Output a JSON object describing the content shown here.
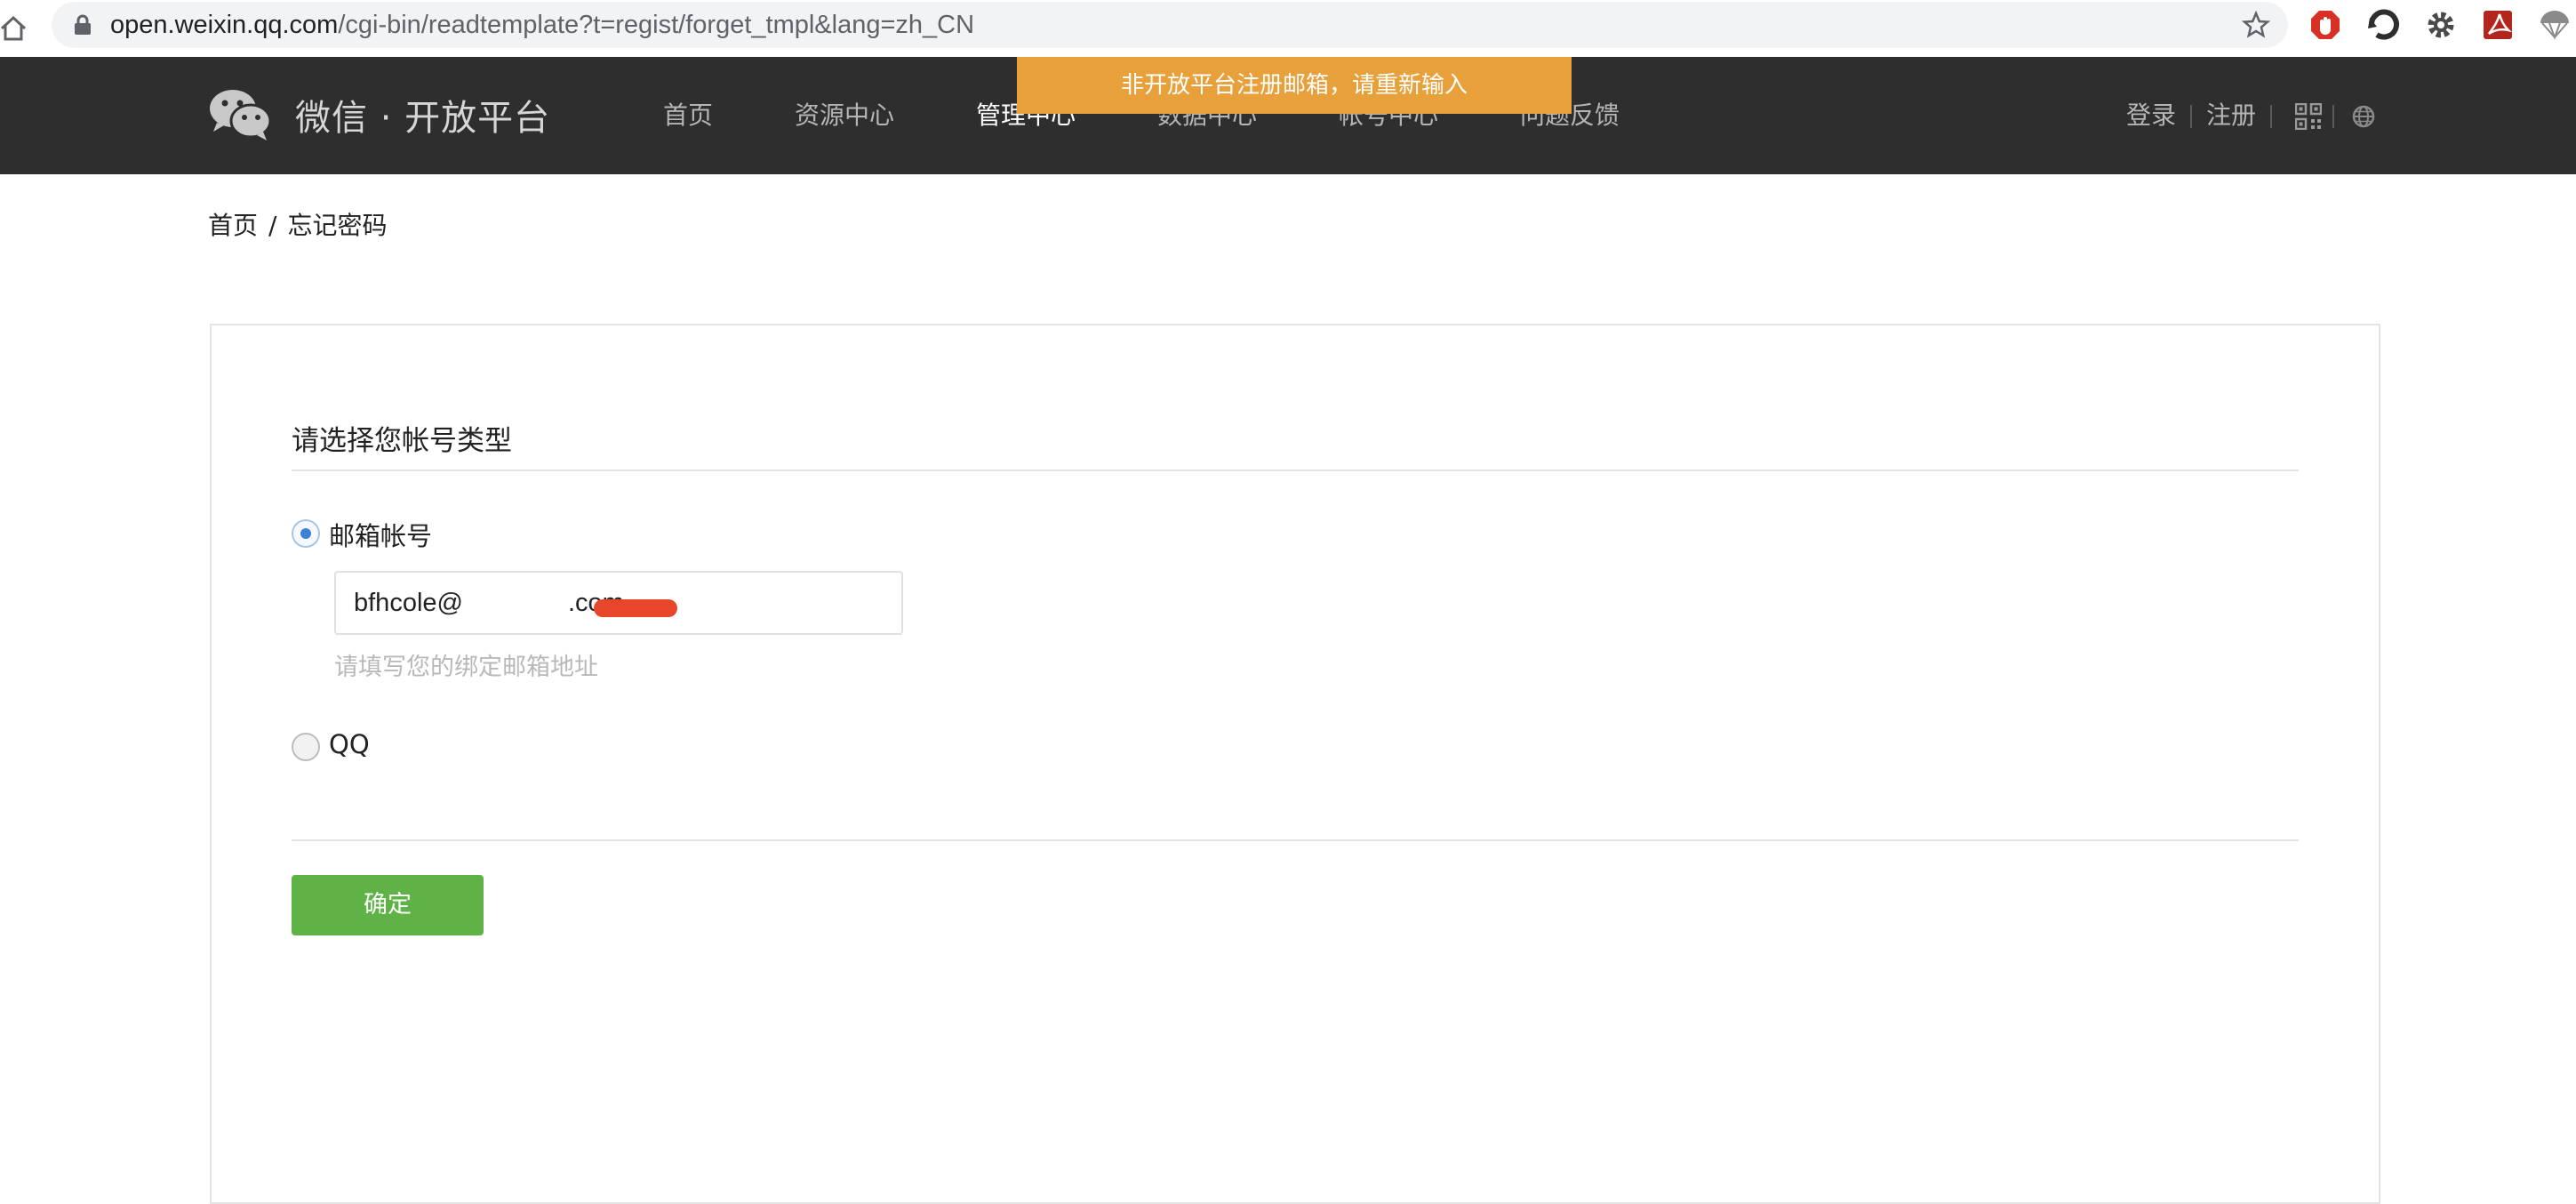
{
  "browser": {
    "url_host": "open.weixin.qq.com",
    "url_path": "/cgi-bin/readtemplate?t=regist/forget_tmpl&lang=zh_CN",
    "icons": [
      "home-icon",
      "lock-icon",
      "star-icon",
      "adblock-icon",
      "undo-icon",
      "gear-icon",
      "pdf-icon",
      "parachute-icon"
    ]
  },
  "nav": {
    "logo_text": "微信 · 开放平台",
    "items": [
      "首页",
      "资源中心",
      "管理中心",
      "数据中心",
      "帐号中心",
      "问题反馈"
    ],
    "active_index": 2,
    "login": "登录",
    "register": "注册"
  },
  "toast": {
    "message": "非开放平台注册邮箱，请重新输入",
    "color": "#e8a13a"
  },
  "breadcrumb": {
    "home": "首页",
    "separator": "/",
    "current": "忘记密码"
  },
  "form": {
    "title": "请选择您帐号类型",
    "options": [
      {
        "label": "邮箱帐号",
        "checked": true
      },
      {
        "label": "QQ",
        "checked": false
      }
    ],
    "email_value": "bfhcole@",
    "email_value_suffix": ".com",
    "email_hint": "请填写您的绑定邮箱地址",
    "confirm_label": "确定",
    "confirm_color": "#5fb346"
  }
}
